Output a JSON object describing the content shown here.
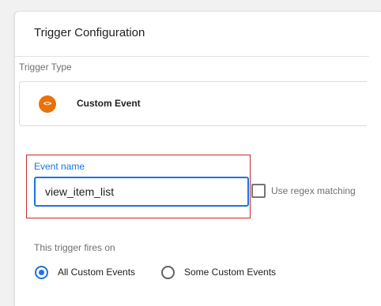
{
  "panel": {
    "title": "Trigger Configuration"
  },
  "trigger_type": {
    "label": "Trigger Type",
    "name": "Custom Event",
    "icon": "code-brackets-icon",
    "icon_glyph": "<>",
    "icon_color": "#e8710a"
  },
  "event_name": {
    "label": "Event name",
    "value": "view_item_list",
    "highlight_color": "#c62828",
    "focus_color": "#1a73e8"
  },
  "regex": {
    "label": "Use regex matching",
    "checked": false
  },
  "fires_on": {
    "label": "This trigger fires on",
    "options": [
      {
        "label": "All Custom Events",
        "selected": true
      },
      {
        "label": "Some Custom Events",
        "selected": false
      }
    ]
  }
}
